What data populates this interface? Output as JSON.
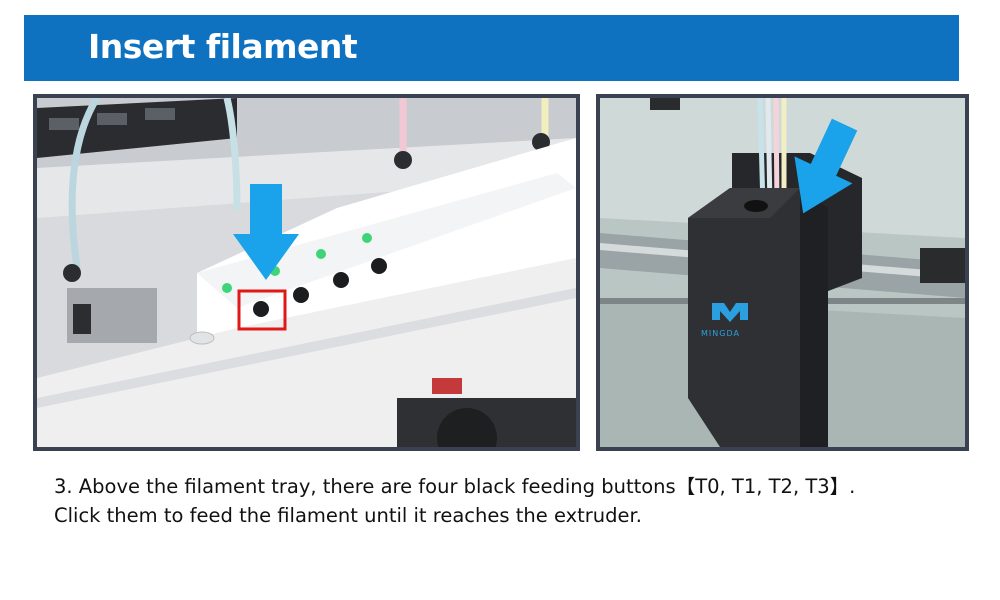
{
  "header": {
    "title": "Insert filament"
  },
  "images": {
    "left": {
      "description_icon": "filament-tray-feed-buttons"
    },
    "right": {
      "description_icon": "extruder-head",
      "logo_text": "MINGDA"
    }
  },
  "caption": {
    "line1": "3.  Above the filament tray, there are four black feeding buttons【T0, T1, T2, T3】.",
    "line2": "Click them to feed the filament until it reaches the extruder."
  },
  "colors": {
    "header_bg": "#0f72c1",
    "arrow": "#1aa3ea",
    "highlight": "#e01818",
    "frame": "#3a4251"
  }
}
